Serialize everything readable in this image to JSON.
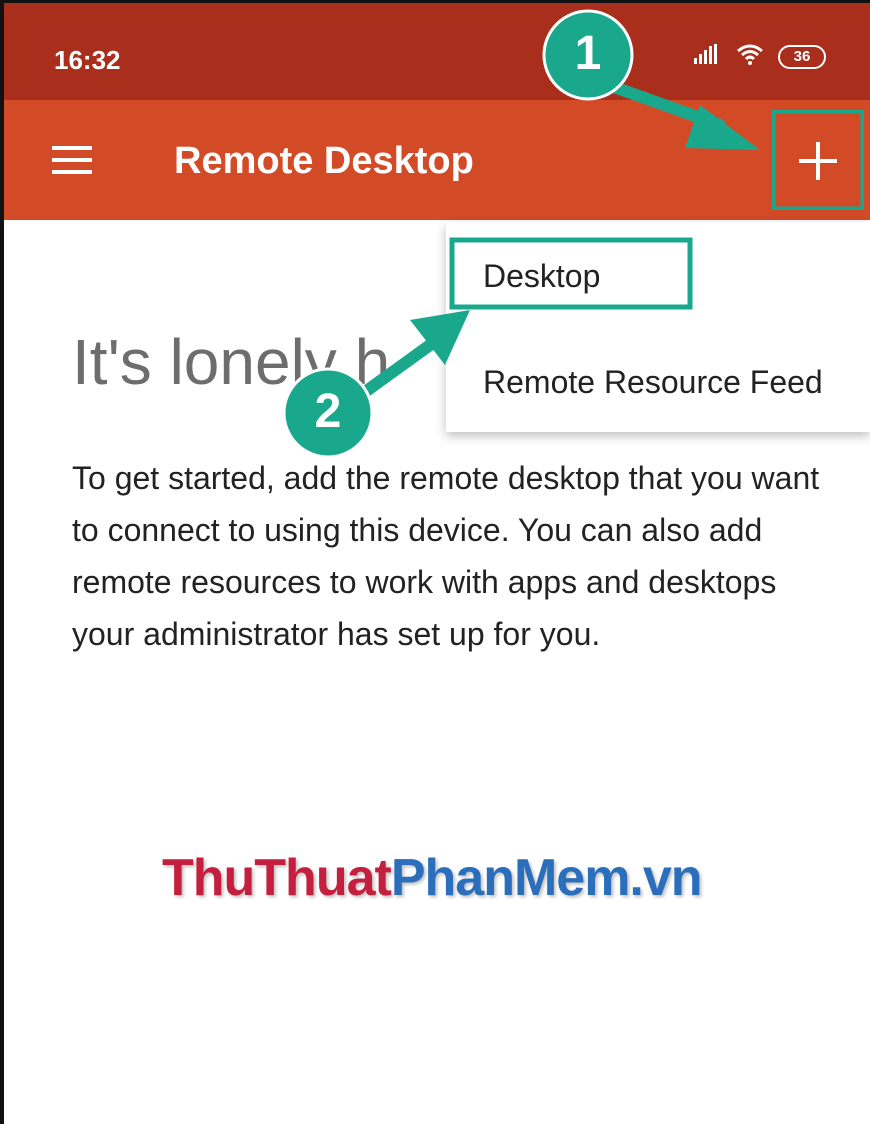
{
  "status_bar": {
    "time": "16:32",
    "battery": "36",
    "icons": [
      "signal-icon",
      "wifi-icon",
      "battery-icon"
    ]
  },
  "app_bar": {
    "title": "Remote Desktop",
    "menu_icon": "hamburger-menu-icon",
    "add_icon": "plus-icon"
  },
  "dropdown": {
    "items": [
      "Desktop",
      "Remote Resource Feed"
    ]
  },
  "empty_state": {
    "heading": "It's lonely h",
    "body": "To get started, add the remote desktop that you want to connect to using this device. You can also add remote resources to work with apps and desktops your administrator has set up for you."
  },
  "watermark": {
    "red_part": "ThuThuat",
    "blue_part": "PhanMem.vn"
  },
  "annotations": {
    "step1": "1",
    "step2": "2",
    "color": "#1aa88d"
  },
  "colors": {
    "status_bar": "#a92e1c",
    "app_bar": "#d24a26"
  }
}
